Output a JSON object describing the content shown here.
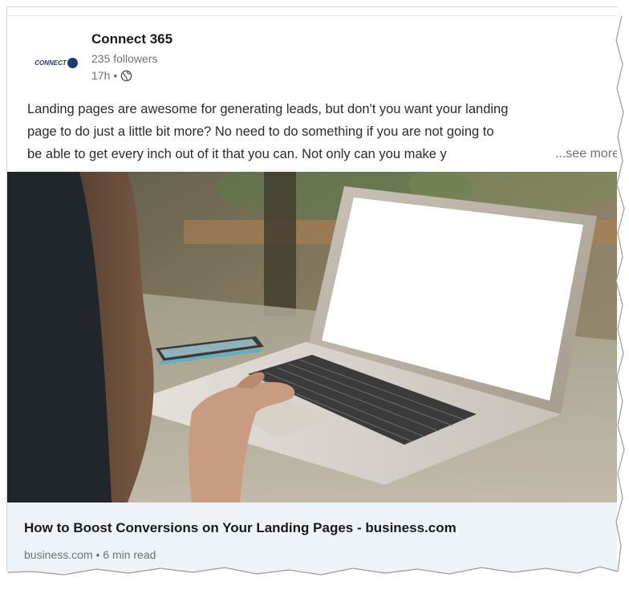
{
  "post": {
    "author": {
      "logo_text": "CONNECT",
      "name": "Connect 365",
      "followers": "235 followers",
      "time": "17h",
      "separator": "•",
      "visibility_icon": "globe-icon"
    },
    "text_lines": [
      "Landing pages are awesome for generating leads, but don't you want your landing",
      "page to do just a little bit more? No need to do something if you are not going to",
      "be able to get every inch out of it that you can. Not only can you make y"
    ],
    "see_more": "...see more",
    "image": {
      "description_icon": "laptop-photo"
    },
    "link_preview": {
      "title": "How to Boost Conversions on Your Landing Pages - business.com",
      "meta": "business.com • 6 min read"
    }
  },
  "colors": {
    "text_primary": "#191919",
    "text_secondary": "#707070",
    "link_bg": "#eef3f8",
    "logo_blue": "#1f3b76"
  }
}
